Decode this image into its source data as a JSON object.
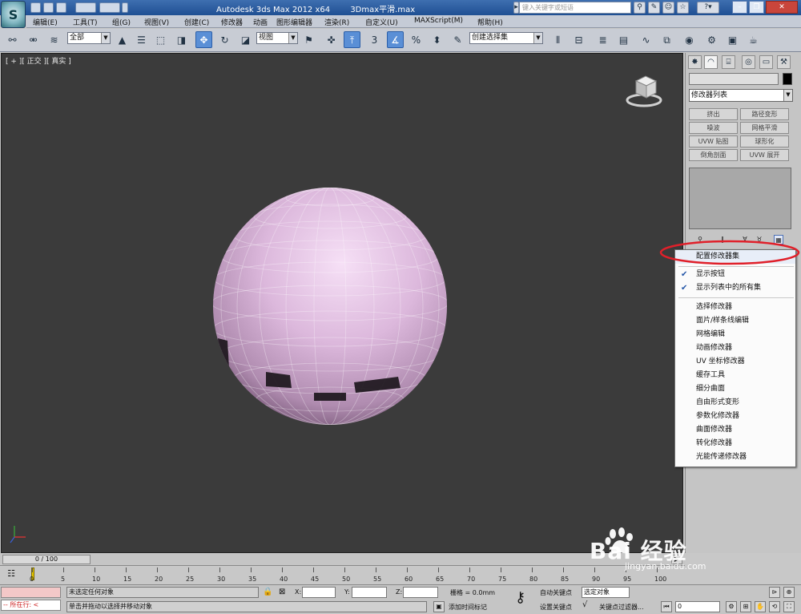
{
  "app": {
    "title": "Autodesk 3ds Max  2012 x64",
    "file": "3Dmax平滑.max",
    "search_placeholder": "键入关键字或短语"
  },
  "menubar": [
    "编辑(E)",
    "工具(T)",
    "组(G)",
    "视图(V)",
    "创建(C)",
    "修改器",
    "动画",
    "图形编辑器",
    "渲染(R)",
    "自定义(U)",
    "MAXScript(M)",
    "帮助(H)"
  ],
  "toolbar": {
    "selection_filter": "全部",
    "ref_coord": "视图",
    "named_selection": "创建选择集",
    "snap_label": "3",
    "percent_label": "%"
  },
  "viewport": {
    "label": "[ + ][ 正交 ][ 真实 ]",
    "background": "#3b3b3b",
    "sphere_color": "#d9b4d9"
  },
  "panel": {
    "modifier_list": "修改器列表",
    "buttons": [
      "挤出",
      "路径变形",
      "噪波",
      "网格平滑",
      "UVW 贴图",
      "球形化",
      "倒角剖面",
      "UVW 展开"
    ]
  },
  "context_menu": {
    "items": [
      {
        "label": "配置修改器集",
        "checked": false
      },
      {
        "label": "显示按钮",
        "checked": true
      },
      {
        "label": "显示列表中的所有集",
        "checked": true
      },
      {
        "label": "选择修改器",
        "checked": false
      },
      {
        "label": "面片/样条线编辑",
        "checked": false
      },
      {
        "label": "网格编辑",
        "checked": false
      },
      {
        "label": "动画修改器",
        "checked": false
      },
      {
        "label": "UV 坐标修改器",
        "checked": false
      },
      {
        "label": "缓存工具",
        "checked": false
      },
      {
        "label": "细分曲面",
        "checked": false
      },
      {
        "label": "自由形式变形",
        "checked": false
      },
      {
        "label": "参数化修改器",
        "checked": false
      },
      {
        "label": "曲面修改器",
        "checked": false
      },
      {
        "label": "转化修改器",
        "checked": false
      },
      {
        "label": "光能传递修改器",
        "checked": false
      }
    ],
    "highlight_color": "#e0202a"
  },
  "timeline": {
    "slider_label": "0 / 100",
    "ticks": [
      "0",
      "5",
      "10",
      "15",
      "20",
      "25",
      "30",
      "35",
      "40",
      "45",
      "50",
      "55",
      "60",
      "65",
      "70",
      "75",
      "80",
      "85",
      "90",
      "95",
      "100"
    ]
  },
  "status": {
    "location": "-- 所在行: <",
    "selection_status": "未选定任何对象",
    "prompt": "单击并拖动以选择并移动对象",
    "x_label": "X:",
    "y_label": "Y:",
    "z_label": "Z:",
    "grid": "栅格 = 0.0mm",
    "add_time_tag": "添加时间标记",
    "auto_key": "自动关键点",
    "set_key": "设置关键点",
    "selected_object": "选定对象",
    "key_filter": "关键点过滤器...",
    "frame": "0"
  },
  "watermark": {
    "brand": "Bai 经验",
    "url": "jingyan.baidu.com"
  }
}
